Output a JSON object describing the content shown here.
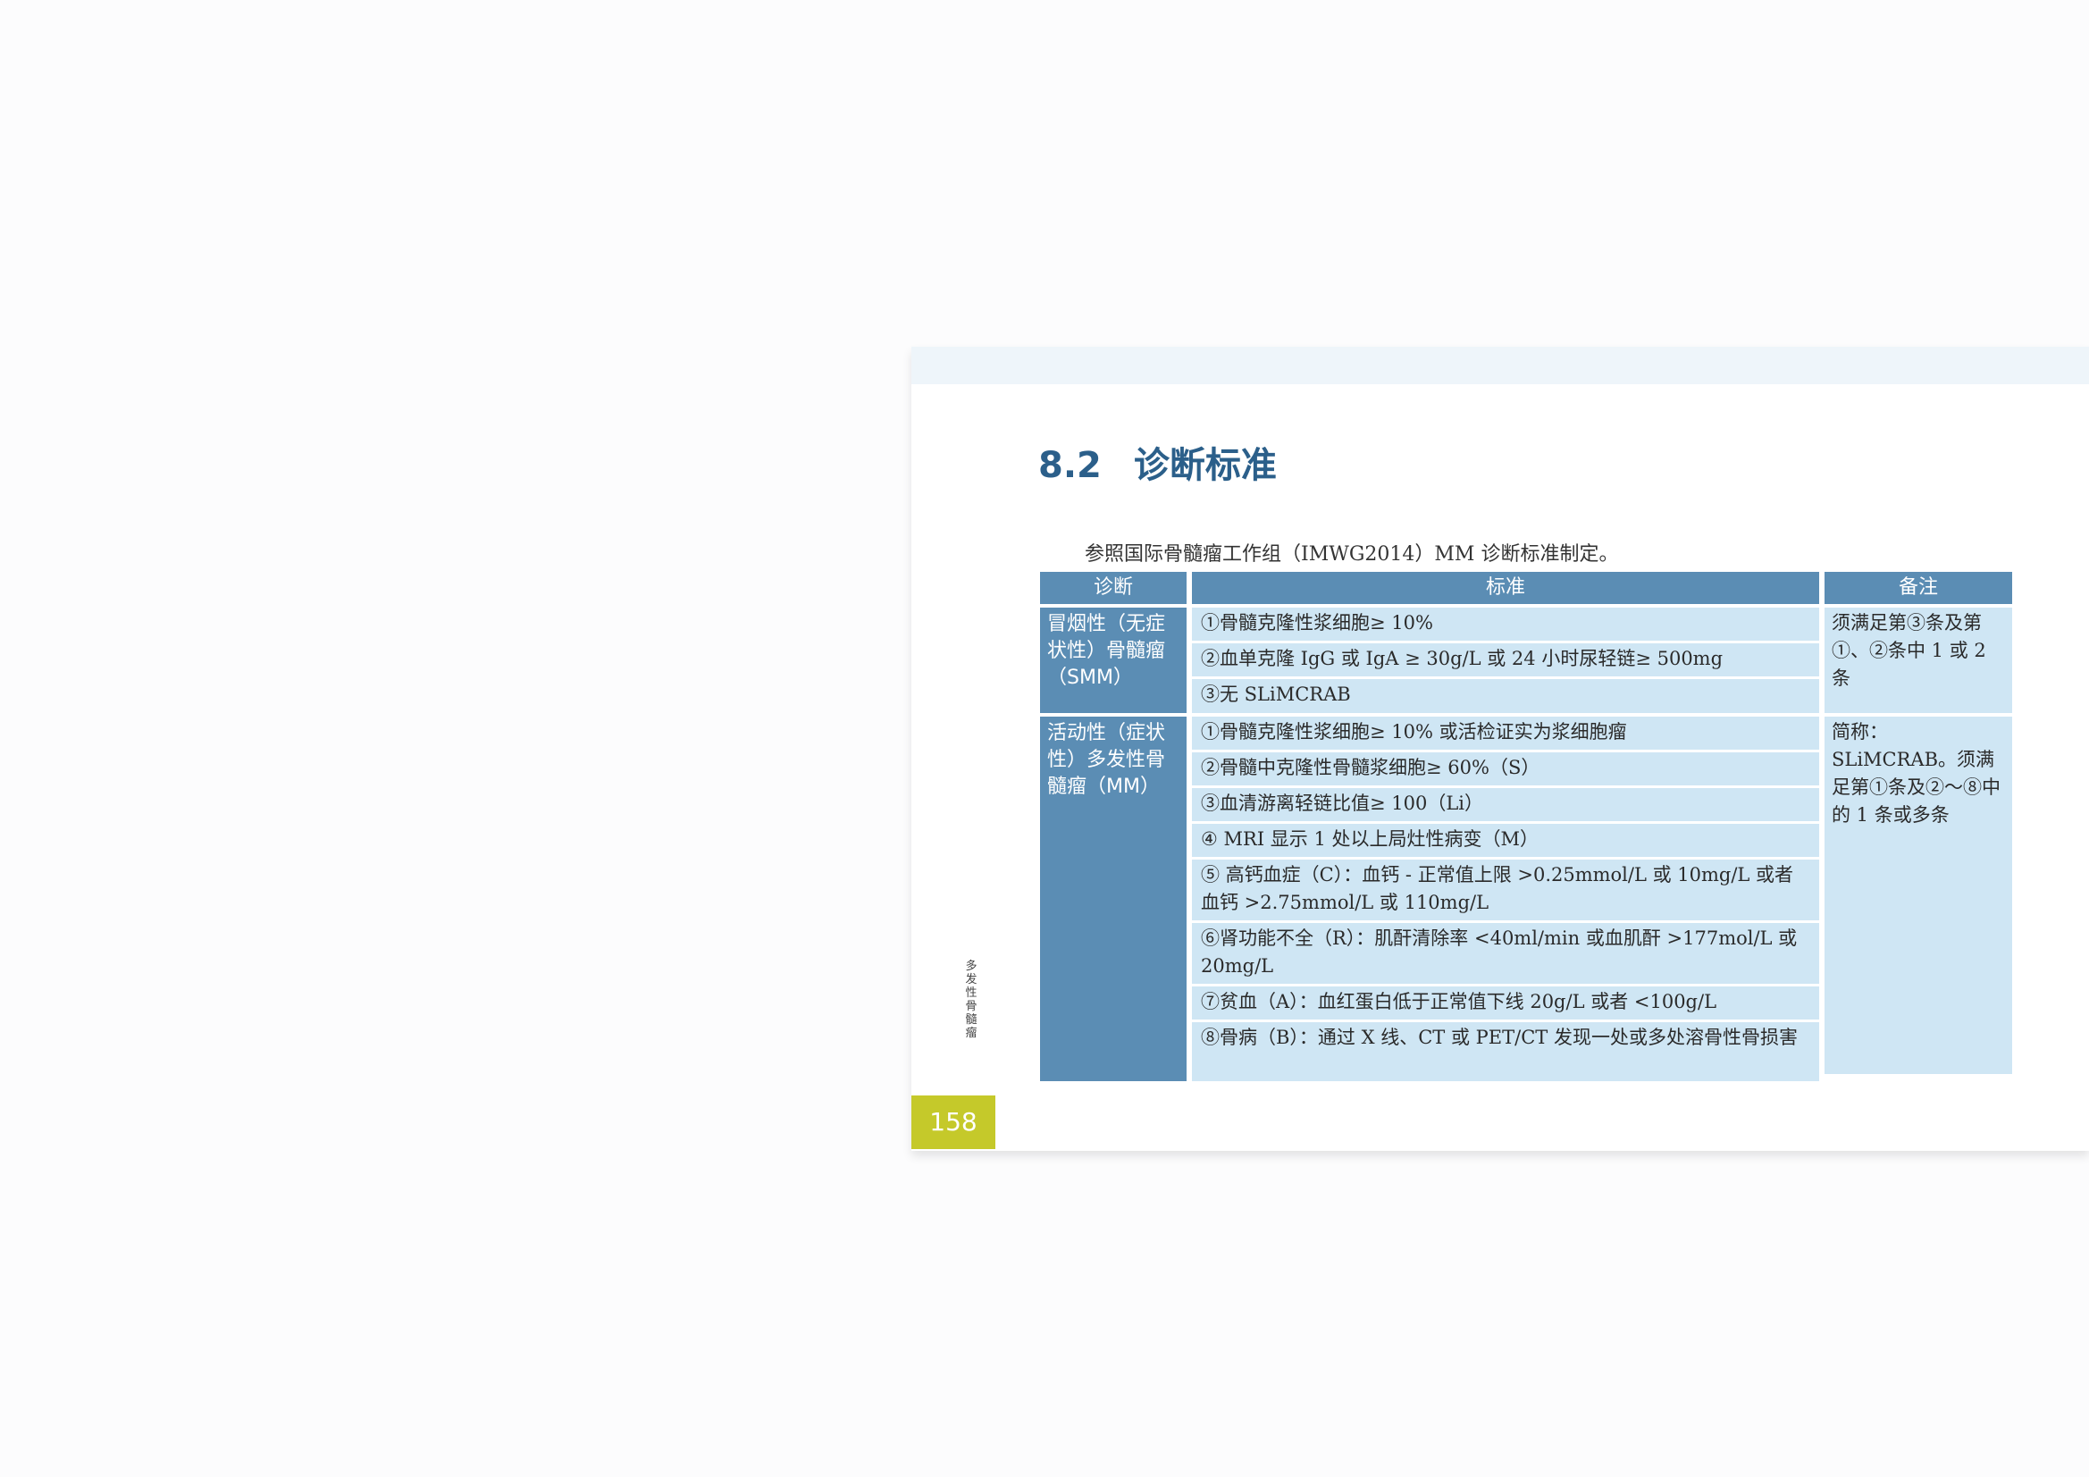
{
  "section": {
    "number": "8.2",
    "title": "诊断标准"
  },
  "intro": "参照国际骨髓瘤工作组（IMWG2014）MM 诊断标准制定。",
  "table": {
    "headers": {
      "diagnosis": "诊断",
      "criteria": "标准",
      "notes": "备注"
    },
    "rows": [
      {
        "diagnosis": "冒烟性（无症状性）骨髓瘤（SMM）",
        "criteria": [
          "①骨髓克隆性浆细胞≥ 10%",
          "②血单克隆 IgG 或 IgA ≥ 30g/L 或 24 小时尿轻链≥ 500mg",
          "③无 SLiMCRAB"
        ],
        "note": "须满足第③条及第①、②条中 1 或 2 条"
      },
      {
        "diagnosis": "活动性（症状性）多发性骨髓瘤（MM）",
        "criteria": [
          "①骨髓克隆性浆细胞≥ 10% 或活检证实为浆细胞瘤",
          "②骨髓中克隆性骨髓浆细胞≥ 60%（S）",
          "③血清游离轻链比值≥ 100（Li）",
          "④ MRI 显示 1 处以上局灶性病变（M）",
          "⑤ 高钙血症（C）：血钙 - 正常值上限 >0.25mmol/L 或 10mg/L 或者血钙 >2.75mmol/L 或 110mg/L",
          "⑥肾功能不全（R）：肌酐清除率 <40ml/min 或血肌酐 >177mol/L 或 20mg/L",
          "⑦贫血（A）：血红蛋白低于正常值下线 20g/L 或者 <100g/L",
          "⑧骨病（B）：通过 X 线、CT 或 PET/CT 发现一处或多处溶骨性骨损害"
        ],
        "note": "简称：SLiMCRAB。须满足第①条及②～⑧中的 1 条或多条"
      }
    ]
  },
  "side_label": "多发性骨髓瘤",
  "page_number": "158"
}
